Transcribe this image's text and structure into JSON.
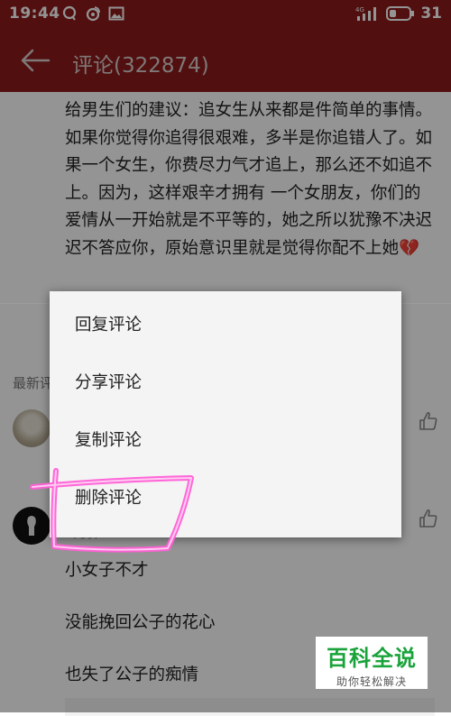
{
  "status_bar": {
    "time": "19:44",
    "network": "4G",
    "battery": "31"
  },
  "app_bar": {
    "title": "评论(322874)"
  },
  "comment": {
    "text": "给男生们的建议：追女生从来都是件简单的事情。如果你觉得你追得很艰难，多半是你追错人了。如果一个女生，你费尽力气才追上，那么还不如追不上。因为，这样艰辛才拥有 一个女朋友，你们的爱情从一开始就是不平等的，她之所以犹豫不决迟迟不答应你，原始意识里就是觉得你配不上她💔"
  },
  "section": {
    "label": "最新评"
  },
  "second_comment": {
    "faded_name": "9月弹",
    "lines": [
      "小女子不才",
      "没能挽回公子的花心",
      "也失了公子的痴情"
    ]
  },
  "context_menu": {
    "items": [
      "回复评论",
      "分享评论",
      "复制评论",
      "删除评论"
    ]
  },
  "watermark": {
    "title": "百科全说",
    "subtitle": "助你轻松解决"
  },
  "colors": {
    "header": "#8e1b1b",
    "annotation": "#ff5fd6",
    "watermark_green": "#1aa33b"
  }
}
